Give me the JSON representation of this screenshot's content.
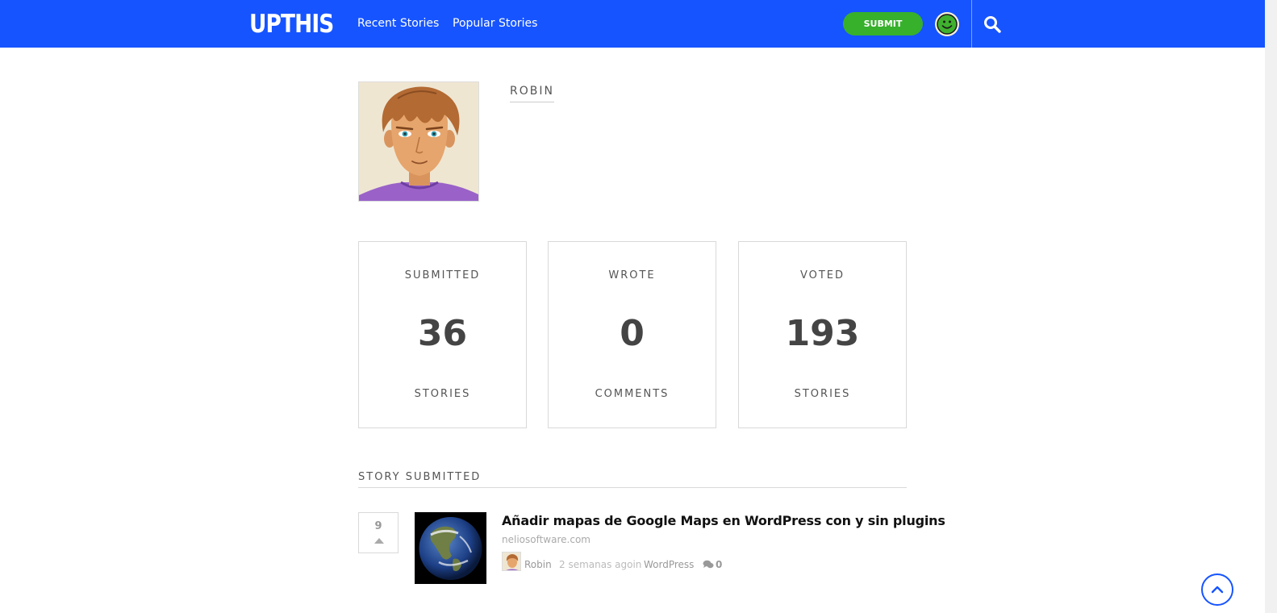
{
  "header": {
    "logo": "UPTHIS",
    "nav": [
      "Recent Stories",
      "Popular Stories"
    ],
    "submit_label": "SUBMIT",
    "brand_color": "#1654ff",
    "submit_color": "#37b02c"
  },
  "profile": {
    "username": "ROBIN"
  },
  "stats": [
    {
      "top": "SUBMITTED",
      "value": "36",
      "bottom": "STORIES"
    },
    {
      "top": "WROTE",
      "value": "0",
      "bottom": "COMMENTS"
    },
    {
      "top": "VOTED",
      "value": "193",
      "bottom": "STORIES"
    }
  ],
  "section": {
    "title": "STORY SUBMITTED"
  },
  "story": {
    "votes": "9",
    "title": "Añadir mapas de Google Maps en WordPress con y sin plugins",
    "domain": "neliosoftware.com",
    "author": "Robin",
    "time": "2 semanas ago",
    "in_label": "in",
    "category": "WordPress",
    "comments": "0"
  },
  "icons": {
    "user_menu": "smiley-icon",
    "search": "search-icon",
    "vote": "upvote-arrow-icon",
    "comments": "comments-icon",
    "scroll_top": "chevron-up-icon"
  }
}
